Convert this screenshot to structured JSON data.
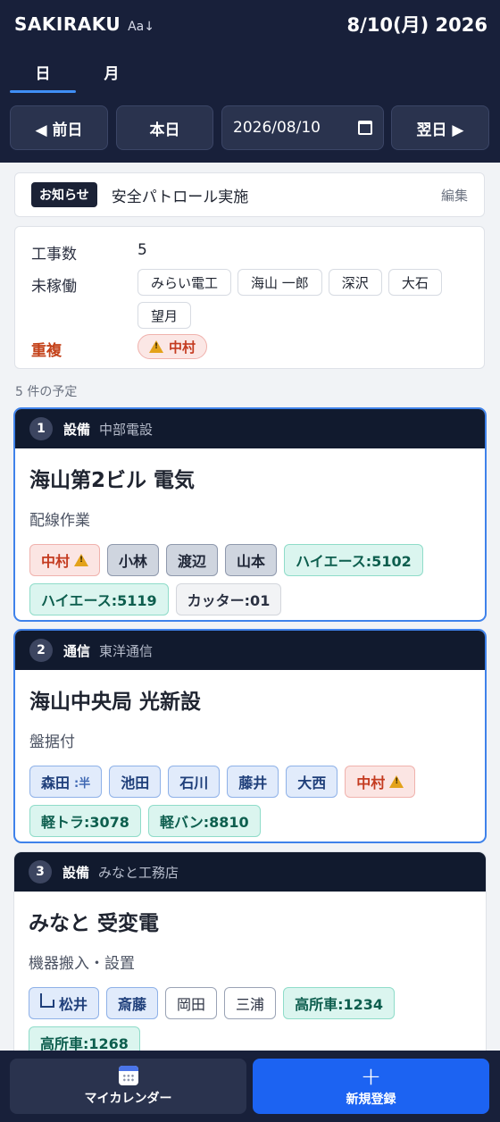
{
  "header": {
    "brand": "SAKIRAKU",
    "font_toggle": "Aa↓",
    "date": "8/10(月) 2026"
  },
  "tabs": [
    {
      "label": "日"
    },
    {
      "label": "月"
    }
  ],
  "nav": {
    "prev": "◀ 前日",
    "today": "本日",
    "date_value": "2026/08/10",
    "next": "翌日 ▶"
  },
  "notice": {
    "badge": "お知らせ",
    "text": "安全パトロール実施",
    "edit": "編集"
  },
  "summary": {
    "works_label": "工事数",
    "works_value": "5",
    "idle_label": "未稼働",
    "idle": [
      "みらい電工",
      "海山 一郎",
      "深沢",
      "大石",
      "望月"
    ],
    "dup_label": "重複",
    "dup": [
      "中村"
    ]
  },
  "count_label": "5 件の予定",
  "cards": [
    {
      "num": "1",
      "category": "設備",
      "company": "中部電設",
      "title": "海山第2ビル 電気",
      "subtitle": "配線作業",
      "chips": [
        {
          "label": "中村",
          "style": "red",
          "icon": "warning-icon"
        },
        {
          "label": "小林",
          "style": "gray"
        },
        {
          "label": "渡辺",
          "style": "gray"
        },
        {
          "label": "山本",
          "style": "gray"
        },
        {
          "label": "ハイエース:5102",
          "style": "teal"
        },
        {
          "label": "ハイエース:5119",
          "style": "teal"
        },
        {
          "label": "カッター:01",
          "style": "light"
        }
      ]
    },
    {
      "num": "2",
      "category": "通信",
      "company": "東洋通信",
      "title": "海山中央局 光新設",
      "subtitle": "盤据付",
      "chips": [
        {
          "label": "森田",
          "style": "blue",
          "suffix": ":半"
        },
        {
          "label": "池田",
          "style": "blue"
        },
        {
          "label": "石川",
          "style": "blue"
        },
        {
          "label": "藤井",
          "style": "blue"
        },
        {
          "label": "大西",
          "style": "blue"
        },
        {
          "label": "中村",
          "style": "red",
          "icon": "warning-icon"
        },
        {
          "label": "軽トラ:3078",
          "style": "teal"
        },
        {
          "label": "軽バン:8810",
          "style": "teal"
        }
      ]
    },
    {
      "num": "3",
      "category": "設備",
      "company": "みなと工務店",
      "title": "みなと 受変電",
      "subtitle": "機器搬入・設置",
      "chips": [
        {
          "label": "松井",
          "style": "blue",
          "icon": "bed-icon"
        },
        {
          "label": "斎藤",
          "style": "blue"
        },
        {
          "label": "岡田",
          "style": "outline"
        },
        {
          "label": "三浦",
          "style": "outline"
        },
        {
          "label": "高所車:1234",
          "style": "teal"
        },
        {
          "label": "高所車:1268",
          "style": "teal"
        }
      ]
    }
  ],
  "bottom": {
    "calendar": "マイカレンダー",
    "new": "新規登録"
  }
}
